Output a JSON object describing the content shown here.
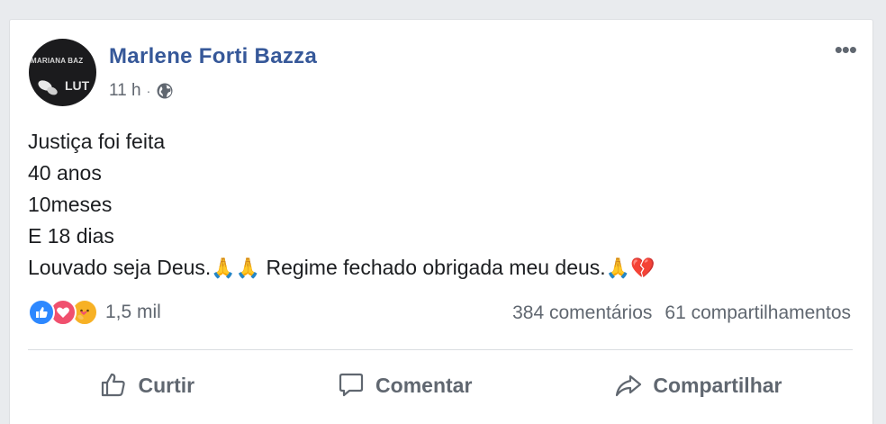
{
  "post": {
    "author": "Marlene Forti Bazza",
    "avatar_text_top": "MARIANA BAZ",
    "avatar_text_bottom": "LUT",
    "time": "11 h",
    "separator": "·",
    "privacy_icon": "globe-icon",
    "more_label": "•••",
    "lines": [
      "Justiça foi feita",
      "40 anos",
      "10meses",
      "E 18 dias"
    ],
    "last_line_a": "Louvado seja Deus.",
    "last_line_emoji_a": "🙏🙏",
    "last_line_b": " Regime fechado obrigada meu deus.",
    "last_line_emoji_b": "🙏💔"
  },
  "stats": {
    "reactions_count": "1,5 mil",
    "comments": "384 comentários",
    "shares": "61 compartilhamentos",
    "reaction_icons": [
      "like-icon",
      "love-icon",
      "care-icon"
    ]
  },
  "actions": {
    "like": "Curtir",
    "comment": "Comentar",
    "share": "Compartilhar"
  },
  "colors": {
    "author": "#365899",
    "like": "#2d88ff",
    "love": "#f0506e",
    "care": "#f7b125",
    "background": "#e9ebee"
  }
}
